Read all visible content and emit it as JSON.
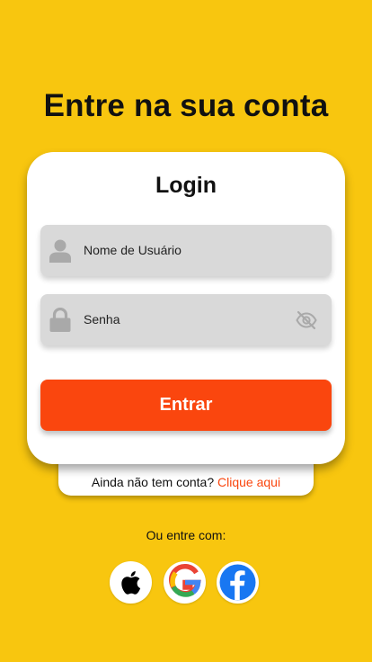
{
  "page": {
    "title": "Entre na sua conta"
  },
  "login_card": {
    "title": "Login",
    "username_placeholder": "Nome de Usuário",
    "password_placeholder": "Senha",
    "submit_label": "Entrar"
  },
  "signup": {
    "prompt": "Ainda não tem conta?",
    "link_label": "Clique aqui"
  },
  "social": {
    "label": "Ou entre com:",
    "providers": [
      {
        "name": "apple",
        "icon": "apple-logo-icon"
      },
      {
        "name": "google",
        "icon": "google-logo-icon"
      },
      {
        "name": "facebook",
        "icon": "facebook-logo-icon"
      }
    ]
  },
  "colors": {
    "background": "#F8C60F",
    "accent": "#FA460E",
    "field_background": "#D9D9D9",
    "card": "#FFFFFF"
  },
  "icons": {
    "username_field": "user-icon",
    "password_field": "lock-icon",
    "password_toggle": "eye-off-icon"
  }
}
